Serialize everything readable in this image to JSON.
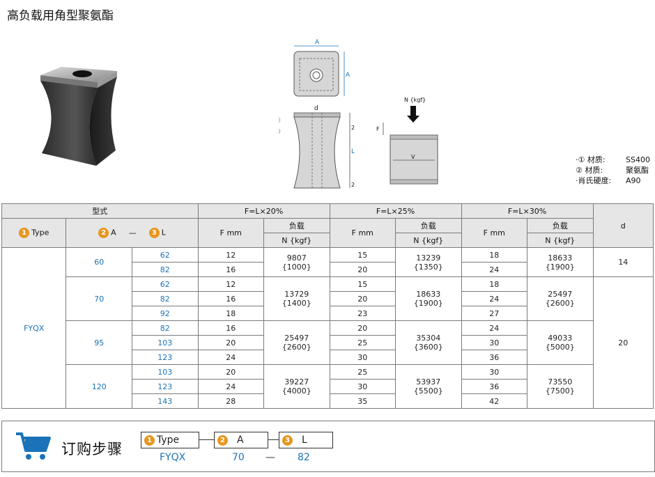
{
  "title": "高负载用角型聚氨酯",
  "diagram": {
    "dim_A_top": "A",
    "dim_A_side": "A",
    "dim_d": "d",
    "dim_2_top": "2",
    "dim_2_bottom": "2",
    "dim_L": "L",
    "dim_F": "F",
    "dim_V": "V",
    "marker_1": "①",
    "marker_2": "②",
    "force_label": "N {kgf}"
  },
  "notes": [
    {
      "key": "·① 材质:",
      "val": "SS400"
    },
    {
      "key": "  ② 材质:",
      "val": "聚氨酯"
    },
    {
      "key": "·肖氏硬度:",
      "val": "A90"
    }
  ],
  "table": {
    "h_type_group": "型式",
    "h_f20": "F=L×20%",
    "h_f25": "F=L×25%",
    "h_f30": "F=L×30%",
    "h_d": "d",
    "b1": "1",
    "b2": "2",
    "b3": "3",
    "h_type": "Type",
    "h_A": "A",
    "h_dash": "—",
    "h_L": "L",
    "h_fmm": "F mm",
    "h_load": "负载",
    "h_nkgf": "N {kgf}",
    "type_value": "FYQX",
    "groups": [
      {
        "A": "60",
        "d": "14",
        "rows": [
          {
            "L": "62",
            "f20": "12",
            "f25": "15",
            "f30": "18"
          },
          {
            "L": "82",
            "f20": "16",
            "f25": "20",
            "f30": "24"
          }
        ],
        "load20": [
          "9807",
          "{1000}"
        ],
        "load25": [
          "13239",
          "{1350}"
        ],
        "load30": [
          "18633",
          "{1900}"
        ]
      },
      {
        "A": "70",
        "rows": [
          {
            "L": "62",
            "f20": "12",
            "f25": "15",
            "f30": "18"
          },
          {
            "L": "82",
            "f20": "16",
            "f25": "20",
            "f30": "24"
          },
          {
            "L": "92",
            "f20": "18",
            "f25": "23",
            "f30": "27"
          }
        ],
        "load20": [
          "13729",
          "{1400}"
        ],
        "load25": [
          "18633",
          "{1900}"
        ],
        "load30": [
          "25497",
          "{2600}"
        ]
      },
      {
        "A": "95",
        "rows": [
          {
            "L": "82",
            "f20": "16",
            "f25": "20",
            "f30": "24"
          },
          {
            "L": "103",
            "f20": "20",
            "f25": "25",
            "f30": "30"
          },
          {
            "L": "123",
            "f20": "24",
            "f25": "30",
            "f30": "36"
          }
        ],
        "load20": [
          "25497",
          "{2600}"
        ],
        "load25": [
          "35304",
          "{3600}"
        ],
        "load30": [
          "49033",
          "{5000}"
        ]
      },
      {
        "A": "120",
        "rows": [
          {
            "L": "103",
            "f20": "20",
            "f25": "25",
            "f30": "30"
          },
          {
            "L": "123",
            "f20": "24",
            "f25": "30",
            "f30": "36"
          },
          {
            "L": "143",
            "f20": "28",
            "f25": "35",
            "f30": "42"
          }
        ],
        "load20": [
          "39227",
          "{4000}"
        ],
        "load25": [
          "53937",
          "{5500}"
        ],
        "load30": [
          "73550",
          "{7500}"
        ]
      }
    ],
    "d_lower": "20"
  },
  "order": {
    "title": "订购步骤",
    "box_type": "Type",
    "box_A": "A",
    "box_L": "L",
    "val_type": "FYQX",
    "val_A": "70",
    "val_dash": "—",
    "val_L": "82"
  },
  "colors": {
    "accent_blue": "#1a73b8",
    "badge_orange": "#e8961e",
    "header_gray": "#e6e6e6"
  }
}
